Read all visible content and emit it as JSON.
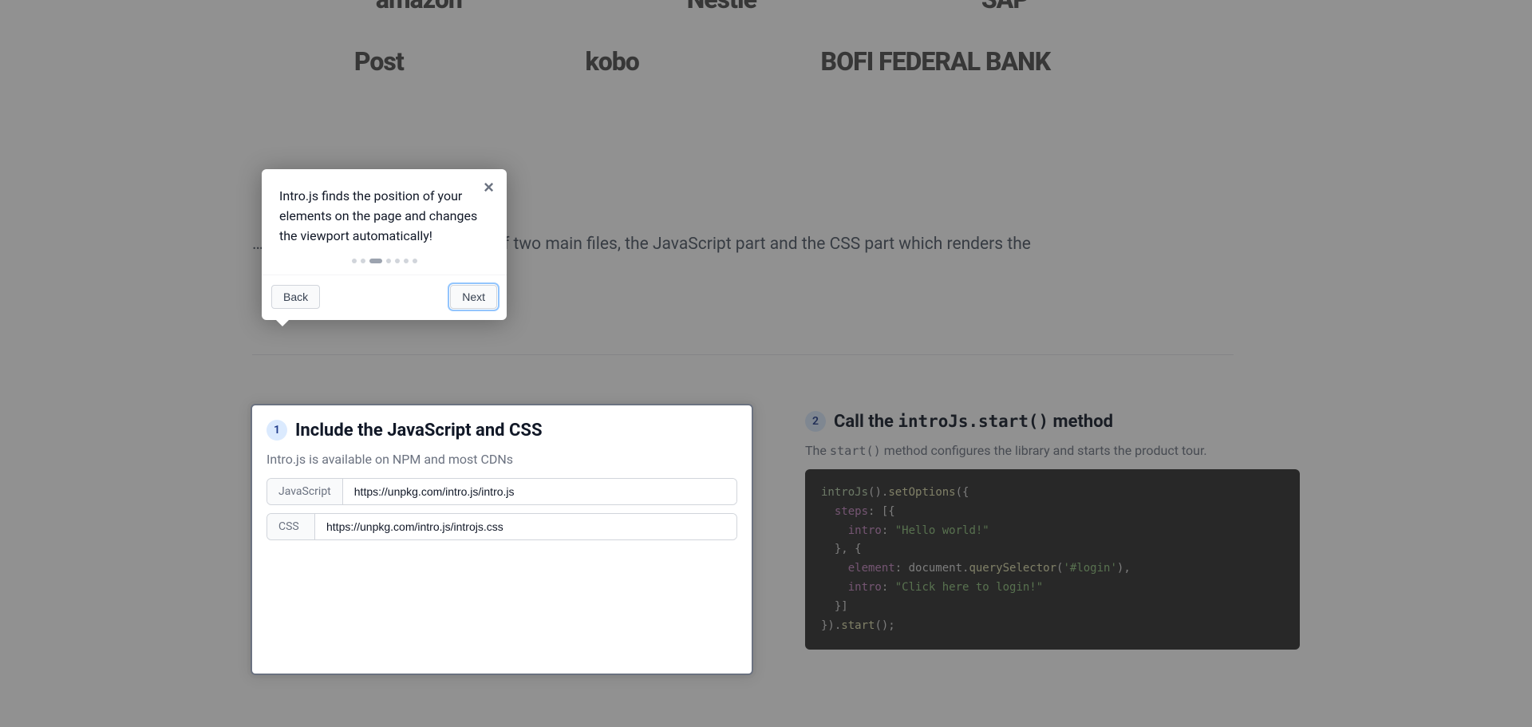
{
  "logos_row1": [
    "amazon",
    "Nestle",
    "SAP"
  ],
  "logos_row2": [
    "Post",
    "kobo",
    "BOFI FEDERAL BANK"
  ],
  "intro_text_fragment": "… simple steps. Intro.js consists of two main files, the JavaScript part and the CSS part which renders the",
  "tooltip": {
    "text": "Intro.js finds the position of your elements on the page and changes the viewport automatically!",
    "back_label": "Back",
    "next_label": "Next",
    "close_label": "×",
    "total_steps": 7,
    "active_step_index": 2
  },
  "step1": {
    "badge": "1",
    "heading": "Include the JavaScript and CSS",
    "subtitle": "Intro.js is available on NPM and most CDNs",
    "js_addon": "JavaScript",
    "js_url": "https://unpkg.com/intro.js/intro.js",
    "css_addon": "CSS",
    "css_url": "https://unpkg.com/intro.js/introjs.css"
  },
  "step2": {
    "badge": "2",
    "heading_prefix": "Call the ",
    "heading_code": "introJs.start()",
    "heading_suffix": " method",
    "subtitle_prefix": "The ",
    "subtitle_code": "start()",
    "subtitle_suffix": " method configures the library and starts the product tour.",
    "code": {
      "lines": [
        {
          "type": "raw",
          "tokens": [
            [
              "fn",
              "introJs"
            ],
            [
              "punc",
              "()."
            ],
            [
              "meth",
              "setOptions"
            ],
            [
              "punc",
              "({"
            ]
          ]
        },
        {
          "type": "raw",
          "tokens": [
            [
              "punc",
              "  "
            ],
            [
              "key",
              "steps"
            ],
            [
              "punc",
              ": [{"
            ]
          ]
        },
        {
          "type": "raw",
          "tokens": [
            [
              "punc",
              "    "
            ],
            [
              "key",
              "intro"
            ],
            [
              "punc",
              ": "
            ],
            [
              "str",
              "\"Hello world!\""
            ]
          ]
        },
        {
          "type": "raw",
          "tokens": [
            [
              "punc",
              "  }, {"
            ]
          ]
        },
        {
          "type": "raw",
          "tokens": [
            [
              "punc",
              "    "
            ],
            [
              "key",
              "element"
            ],
            [
              "punc",
              ": document."
            ],
            [
              "meth",
              "querySelector"
            ],
            [
              "punc",
              "("
            ],
            [
              "str",
              "'#login'"
            ],
            [
              "punc",
              "),"
            ]
          ]
        },
        {
          "type": "raw",
          "tokens": [
            [
              "punc",
              "    "
            ],
            [
              "key",
              "intro"
            ],
            [
              "punc",
              ": "
            ],
            [
              "str",
              "\"Click here to login!\""
            ]
          ]
        },
        {
          "type": "raw",
          "tokens": [
            [
              "punc",
              "  }]"
            ]
          ]
        },
        {
          "type": "raw",
          "tokens": [
            [
              "punc",
              "})."
            ],
            [
              "meth",
              "start"
            ],
            [
              "punc",
              "();"
            ]
          ]
        }
      ]
    }
  }
}
